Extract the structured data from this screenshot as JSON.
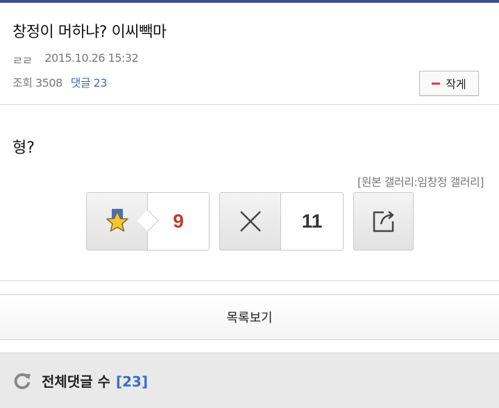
{
  "post": {
    "title": "창정이 머하냐? 이씨빽마",
    "author": "ㄹㄹ",
    "datetime": "2015.10.26 15:32",
    "views_label": "조회 3508",
    "comments_label": "댓글 23",
    "font_small_label": "작게",
    "body": "형?",
    "source": "[원본 갤러리:임창정 갤러리]"
  },
  "votes": {
    "up_count": "9",
    "down_count": "11"
  },
  "list_button_label": "목록보기",
  "comments": {
    "title": "전체댓글 수",
    "count": "[23]"
  },
  "colors": {
    "accent_blue": "#3a6fc4",
    "up_red": "#c0392b",
    "minus_red": "#e23b3b",
    "topbar": "#3b4a8a"
  },
  "icons": [
    "star-icon",
    "x-icon",
    "share-icon",
    "refresh-icon",
    "minus-icon"
  ]
}
